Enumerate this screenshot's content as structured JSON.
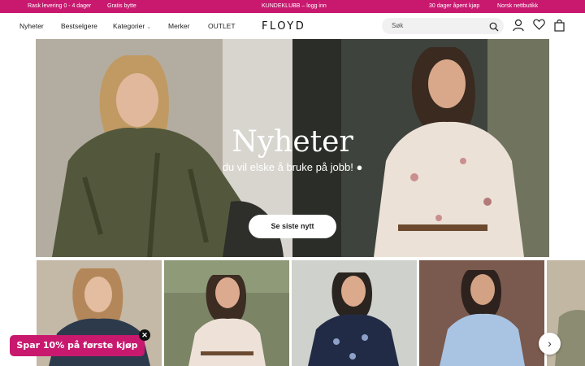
{
  "topbar": {
    "shipping": "Rask levering 0 - 4 dager",
    "returns": "Gratis bytte",
    "club": "KUNDEKLUBB  –  logg inn",
    "purchase": "30 dager åpent kjøp",
    "store": "Norsk nettbutikk",
    "bg_color": "#c8196f"
  },
  "header": {
    "nav": [
      "Nyheter",
      "Bestselgere",
      "Kategorier",
      "Merker",
      "OUTLET"
    ],
    "logo": "FLOYD",
    "search_placeholder": "Søk",
    "icons": [
      "search-icon",
      "user-icon",
      "heart-icon",
      "bag-icon"
    ]
  },
  "hero": {
    "title": "Nyheter",
    "subtitle": "du vil elske å bruke på jobb! ●",
    "cta": "Se siste nytt"
  },
  "promo": {
    "label": "Spar 10% på første kjøp",
    "close": "✕"
  },
  "carousel": {
    "next": "›"
  }
}
